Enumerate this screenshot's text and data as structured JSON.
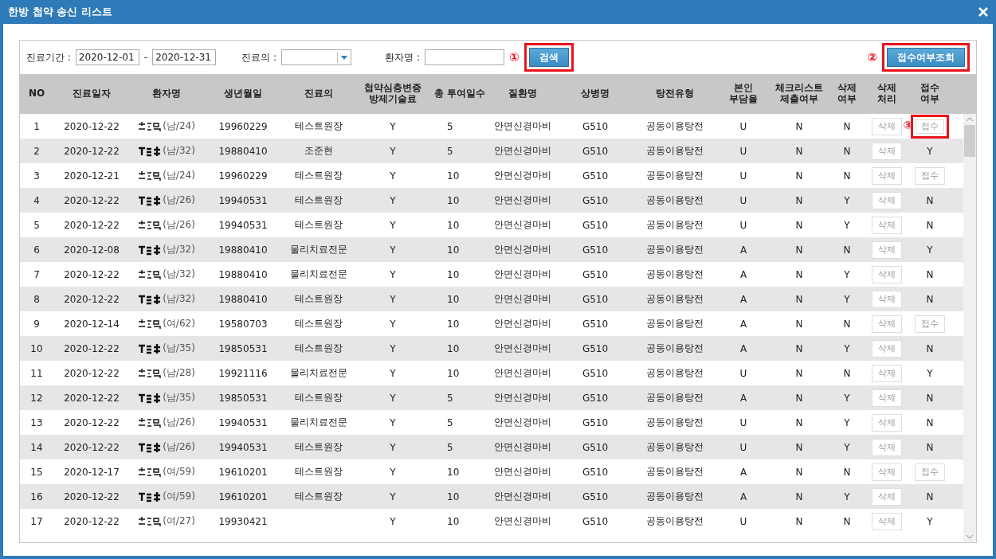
{
  "window": {
    "title": "한방 첩약 송신 리스트"
  },
  "filters": {
    "period_label": "진료기간 :",
    "date_from": "2020-12-01",
    "date_separator": "-",
    "date_to": "2020-12-31",
    "doctor_label": "진료의 :",
    "patient_label": "환자명 :",
    "search_marker": "①",
    "search_button": "검색",
    "search_highlighted": true,
    "check_marker": "②",
    "check_button": "접수여부조회",
    "check_highlighted": true
  },
  "table": {
    "columns": [
      "NO",
      "진료일자",
      "환자명",
      "생년월일",
      "진료의",
      "첩약심층변증\n방제기술료",
      "총 투여일수",
      "질환명",
      "상병명",
      "탕전유형",
      "본인\n부담율",
      "체크리스트\n제출여부",
      "삭제\n여부",
      "삭제\n처리",
      "접수\n여부"
    ],
    "rows": [
      {
        "no": "1",
        "date": "2020-12-22",
        "patient": "(남/24)",
        "birth": "19960229",
        "doctor": "테스트원장",
        "fee": "Y",
        "days": "5",
        "disease": "안면신경마비",
        "code": "G510",
        "type": "공동이용탕전",
        "burden": "U",
        "checklist": "N",
        "deleted": "N",
        "delete_button": "삭제",
        "marker": "③",
        "receipt": {
          "kind": "button",
          "label": "접수",
          "highlighted": true
        }
      },
      {
        "no": "2",
        "date": "2020-12-22",
        "patient": "(남/32)",
        "birth": "19880410",
        "doctor": "조준현",
        "fee": "Y",
        "days": "5",
        "disease": "안면신경마비",
        "code": "G510",
        "type": "공동이용탕전",
        "burden": "U",
        "checklist": "N",
        "deleted": "N",
        "delete_button": "삭제",
        "receipt": {
          "kind": "text",
          "label": "Y"
        }
      },
      {
        "no": "3",
        "date": "2020-12-21",
        "patient": "(남/24)",
        "birth": "19960229",
        "doctor": "테스트원장",
        "fee": "Y",
        "days": "10",
        "disease": "안면신경마비",
        "code": "G510",
        "type": "공동이용탕전",
        "burden": "U",
        "checklist": "N",
        "deleted": "N",
        "delete_button": "삭제",
        "receipt": {
          "kind": "button",
          "label": "접수",
          "highlighted": false
        }
      },
      {
        "no": "4",
        "date": "2020-12-22",
        "patient": "(남/26)",
        "birth": "19940531",
        "doctor": "테스트원장",
        "fee": "Y",
        "days": "10",
        "disease": "안면신경마비",
        "code": "G510",
        "type": "공동이용탕전",
        "burden": "U",
        "checklist": "N",
        "deleted": "Y",
        "delete_button": "삭제",
        "receipt": {
          "kind": "text",
          "label": "N"
        }
      },
      {
        "no": "5",
        "date": "2020-12-22",
        "patient": "(남/26)",
        "birth": "19940531",
        "doctor": "테스트원장",
        "fee": "Y",
        "days": "10",
        "disease": "안면신경마비",
        "code": "G510",
        "type": "공동이용탕전",
        "burden": "U",
        "checklist": "N",
        "deleted": "Y",
        "delete_button": "삭제",
        "receipt": {
          "kind": "text",
          "label": "N"
        }
      },
      {
        "no": "6",
        "date": "2020-12-08",
        "patient": "(남/32)",
        "birth": "19880410",
        "doctor": "물리치료전문",
        "fee": "Y",
        "days": "10",
        "disease": "안면신경마비",
        "code": "G510",
        "type": "공동이용탕전",
        "burden": "A",
        "checklist": "N",
        "deleted": "N",
        "delete_button": "삭제",
        "receipt": {
          "kind": "text",
          "label": "Y"
        }
      },
      {
        "no": "7",
        "date": "2020-12-22",
        "patient": "(남/32)",
        "birth": "19880410",
        "doctor": "물리치료전문",
        "fee": "Y",
        "days": "10",
        "disease": "안면신경마비",
        "code": "G510",
        "type": "공동이용탕전",
        "burden": "A",
        "checklist": "N",
        "deleted": "Y",
        "delete_button": "삭제",
        "receipt": {
          "kind": "text",
          "label": "N"
        }
      },
      {
        "no": "8",
        "date": "2020-12-22",
        "patient": "(남/32)",
        "birth": "19880410",
        "doctor": "테스트원장",
        "fee": "Y",
        "days": "10",
        "disease": "안면신경마비",
        "code": "G510",
        "type": "공동이용탕전",
        "burden": "A",
        "checklist": "N",
        "deleted": "Y",
        "delete_button": "삭제",
        "receipt": {
          "kind": "text",
          "label": "N"
        }
      },
      {
        "no": "9",
        "date": "2020-12-14",
        "patient": "(여/62)",
        "birth": "19580703",
        "doctor": "테스트원장",
        "fee": "Y",
        "days": "10",
        "disease": "안면신경마비",
        "code": "G510",
        "type": "공동이용탕전",
        "burden": "A",
        "checklist": "N",
        "deleted": "N",
        "delete_button": "삭제",
        "receipt": {
          "kind": "button",
          "label": "접수",
          "highlighted": false
        }
      },
      {
        "no": "10",
        "date": "2020-12-22",
        "patient": "(남/35)",
        "birth": "19850531",
        "doctor": "테스트원장",
        "fee": "Y",
        "days": "10",
        "disease": "안면신경마비",
        "code": "G510",
        "type": "공동이용탕전",
        "burden": "A",
        "checklist": "N",
        "deleted": "Y",
        "delete_button": "삭제",
        "receipt": {
          "kind": "text",
          "label": "N"
        }
      },
      {
        "no": "11",
        "date": "2020-12-22",
        "patient": "(남/28)",
        "birth": "19921116",
        "doctor": "물리치료전문",
        "fee": "Y",
        "days": "10",
        "disease": "안면신경마비",
        "code": "G510",
        "type": "공동이용탕전",
        "burden": "U",
        "checklist": "N",
        "deleted": "N",
        "delete_button": "삭제",
        "receipt": {
          "kind": "text",
          "label": "Y"
        }
      },
      {
        "no": "12",
        "date": "2020-12-22",
        "patient": "(남/35)",
        "birth": "19850531",
        "doctor": "테스트원장",
        "fee": "Y",
        "days": "5",
        "disease": "안면신경마비",
        "code": "G510",
        "type": "공동이용탕전",
        "burden": "A",
        "checklist": "N",
        "deleted": "Y",
        "delete_button": "삭제",
        "receipt": {
          "kind": "text",
          "label": "N"
        }
      },
      {
        "no": "13",
        "date": "2020-12-22",
        "patient": "(남/26)",
        "birth": "19940531",
        "doctor": "물리치료전문",
        "fee": "Y",
        "days": "5",
        "disease": "안면신경마비",
        "code": "G510",
        "type": "공동이용탕전",
        "burden": "U",
        "checklist": "N",
        "deleted": "Y",
        "delete_button": "삭제",
        "receipt": {
          "kind": "text",
          "label": "N"
        }
      },
      {
        "no": "14",
        "date": "2020-12-22",
        "patient": "(남/26)",
        "birth": "19940531",
        "doctor": "테스트원장",
        "fee": "Y",
        "days": "5",
        "disease": "안면신경마비",
        "code": "G510",
        "type": "공동이용탕전",
        "burden": "U",
        "checklist": "N",
        "deleted": "Y",
        "delete_button": "삭제",
        "receipt": {
          "kind": "text",
          "label": "N"
        }
      },
      {
        "no": "15",
        "date": "2020-12-17",
        "patient": "(여/59)",
        "birth": "19610201",
        "doctor": "테스트원장",
        "fee": "Y",
        "days": "10",
        "disease": "안면신경마비",
        "code": "G510",
        "type": "공동이용탕전",
        "burden": "A",
        "checklist": "N",
        "deleted": "N",
        "delete_button": "삭제",
        "receipt": {
          "kind": "button",
          "label": "접수",
          "highlighted": false
        }
      },
      {
        "no": "16",
        "date": "2020-12-22",
        "patient": "(여/59)",
        "birth": "19610201",
        "doctor": "테스트원장",
        "fee": "Y",
        "days": "10",
        "disease": "안면신경마비",
        "code": "G510",
        "type": "공동이용탕전",
        "burden": "A",
        "checklist": "N",
        "deleted": "Y",
        "delete_button": "삭제",
        "receipt": {
          "kind": "text",
          "label": "N"
        }
      },
      {
        "no": "17",
        "date": "2020-12-22",
        "patient": "(여/27)",
        "birth": "19930421",
        "fee": "Y",
        "days": "10",
        "disease": "안면신경마비",
        "code": "G510",
        "type": "공동이용탕전",
        "burden": "U",
        "checklist": "N",
        "deleted": "N",
        "delete_button": "삭제",
        "receipt": {
          "kind": "text",
          "label": "Y"
        }
      }
    ]
  }
}
